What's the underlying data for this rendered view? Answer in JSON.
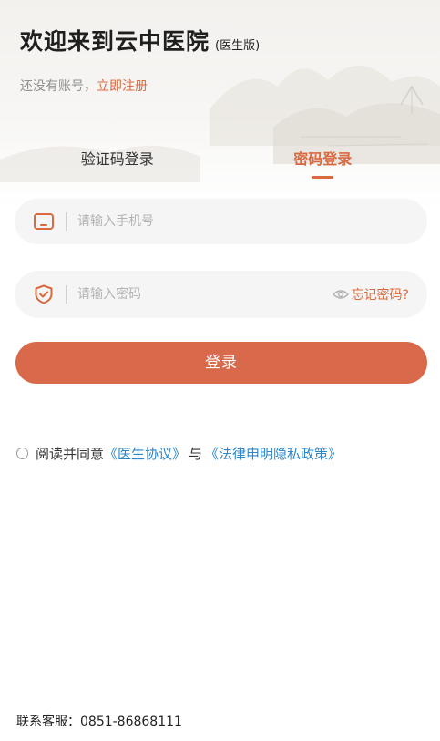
{
  "header": {
    "title": "欢迎来到云中医院",
    "edition": "(医生版)",
    "subtitle_prefix": "还没有账号，",
    "register_link": "立即注册"
  },
  "tabs": [
    {
      "label": "验证码登录",
      "active": false
    },
    {
      "label": "密码登录",
      "active": true
    }
  ],
  "phone_field": {
    "placeholder": "请输入手机号",
    "value": "",
    "icon": "phone-icon"
  },
  "password_field": {
    "placeholder": "请输入密码",
    "value": "",
    "icon": "shield-check-icon",
    "forgot_label": "忘记密码?",
    "forgot_icon": "eye-icon"
  },
  "login_button": {
    "label": "登录"
  },
  "agreement": {
    "prefix": "阅读并同意",
    "doctor_agreement": "《医生协议》",
    "and": "与",
    "privacy_policy": "《法律申明隐私政策》",
    "checked": false
  },
  "footer": {
    "service_label": "联系客服：",
    "service_phone": "0851-86868111"
  },
  "colors": {
    "accent": "#d9693f",
    "button": "#d86a4b",
    "link": "#2d86c8",
    "field_bg": "#f5f5f5"
  }
}
